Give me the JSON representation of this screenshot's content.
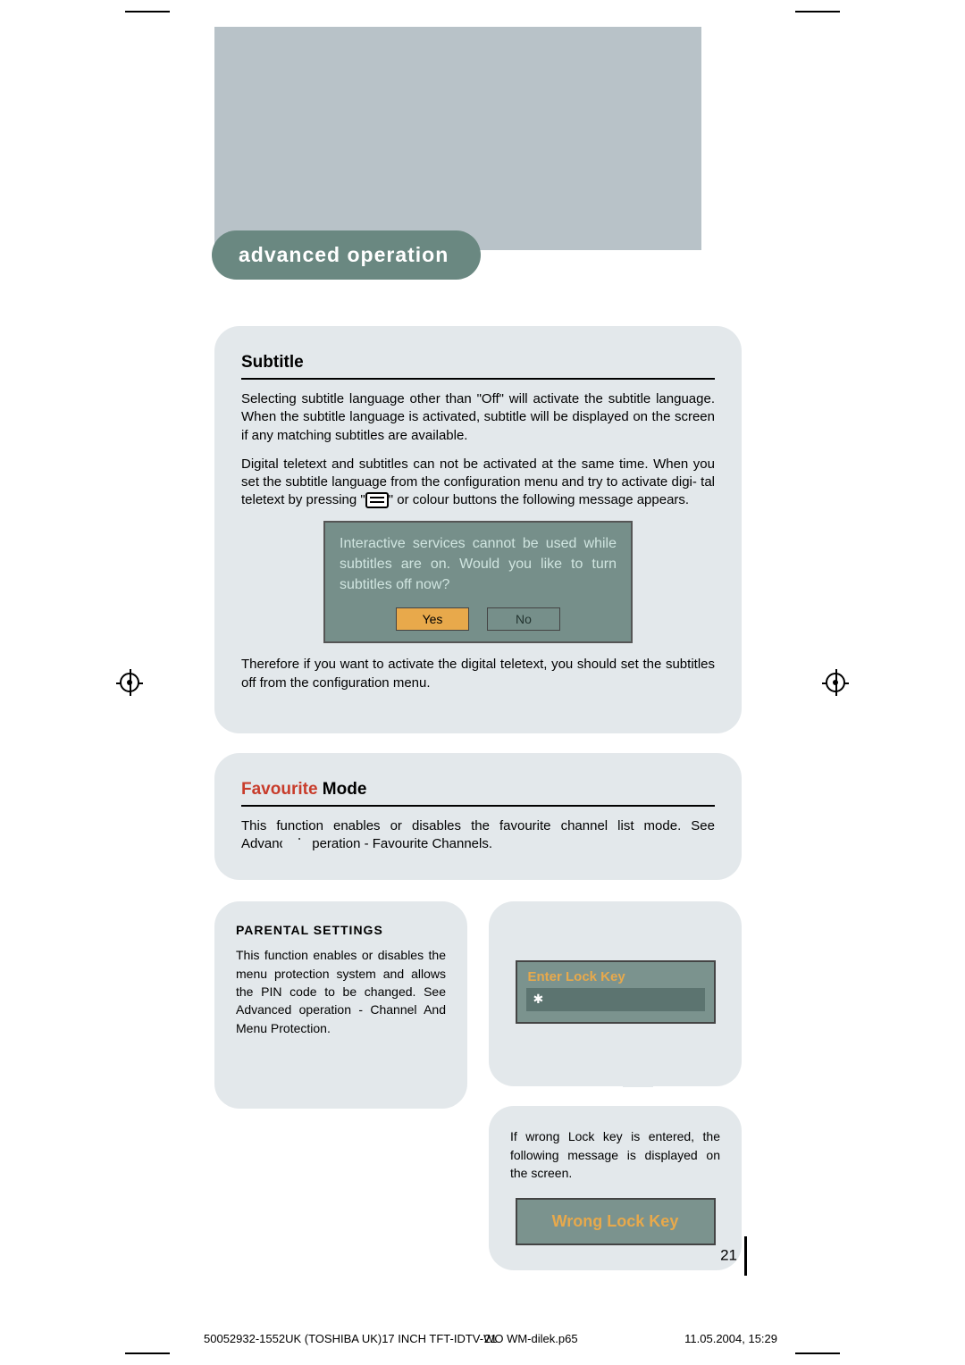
{
  "header": {
    "tab": "advanced operation"
  },
  "subtitle_section": {
    "title": "Subtitle",
    "p1": "Selecting subtitle language other than \"Off\" will activate the subtitle language. When the subtitle language is activated, subtitle will be displayed on the screen if any matching subtitles are available.",
    "p2a": "Digital teletext and subtitles can not be activated at the same time. When you set the subtitle language from the configuration menu and try to activate digi-",
    "p2b": "tal teletext by pressing \"",
    "p2c": "\" or colour buttons the following message appears.",
    "dialog_text": "Interactive services cannot be used while subtitles are on. Would you like to turn subtitles off now?",
    "dialog_yes": "Yes",
    "dialog_no": "No",
    "p3": "Therefore if you want to activate the digital teletext, you should set the subtitles off from the configuration menu."
  },
  "favourite_section": {
    "title_red": "Favourite",
    "title_rest": " Mode",
    "body": "This function enables or disables the favourite channel list mode.  See Advanced operation - Favourite Channels."
  },
  "parental_section": {
    "title": "PARENTAL SETTINGS",
    "body": "This function enables or disables the menu protection system and allows the PIN code to be changed. See Advanced operation - Channel And Menu Protection."
  },
  "enter_key": {
    "header": "Enter Lock Key",
    "value": "✱"
  },
  "wrong_key_section": {
    "body": "If wrong Lock key is entered, the following message is displayed on the screen.",
    "banner": "Wrong Lock Key"
  },
  "page_number": "21",
  "footer": {
    "left": "50052932-1552UK (TOSHIBA UK)17 INCH TFT-IDTV-WO WM-dilek.p65",
    "mid": "21",
    "right": "11.05.2004, 15:29"
  }
}
